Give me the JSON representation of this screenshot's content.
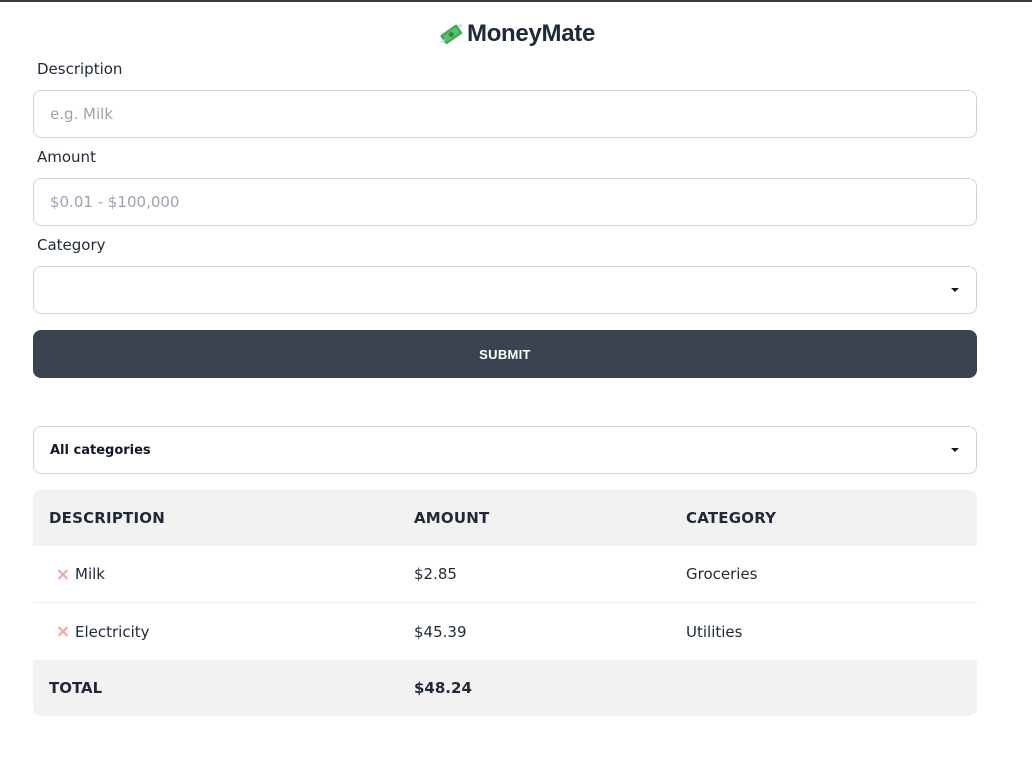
{
  "app": {
    "title": "MoneyMate",
    "icon": "money-with-wings-icon"
  },
  "form": {
    "description_label": "Description",
    "description_placeholder": "e.g. Milk",
    "description_value": "",
    "amount_label": "Amount",
    "amount_placeholder": "$0.01 - $100,000",
    "amount_value": "",
    "category_label": "Category",
    "category_value": "",
    "submit_label": "SUBMIT"
  },
  "filter": {
    "selected": "All categories"
  },
  "table": {
    "headers": [
      "DESCRIPTION",
      "AMOUNT",
      "CATEGORY"
    ],
    "rows": [
      {
        "description": "Milk",
        "amount": "$2.85",
        "category": "Groceries"
      },
      {
        "description": "Electricity",
        "amount": "$45.39",
        "category": "Utilities"
      }
    ],
    "total_label": "TOTAL",
    "total_amount": "$48.24"
  },
  "colors": {
    "primary_button": "#3b4350",
    "table_header_bg": "#f2f2f2",
    "delete_icon": "#f0a6a6",
    "border": "#d1d5db"
  }
}
